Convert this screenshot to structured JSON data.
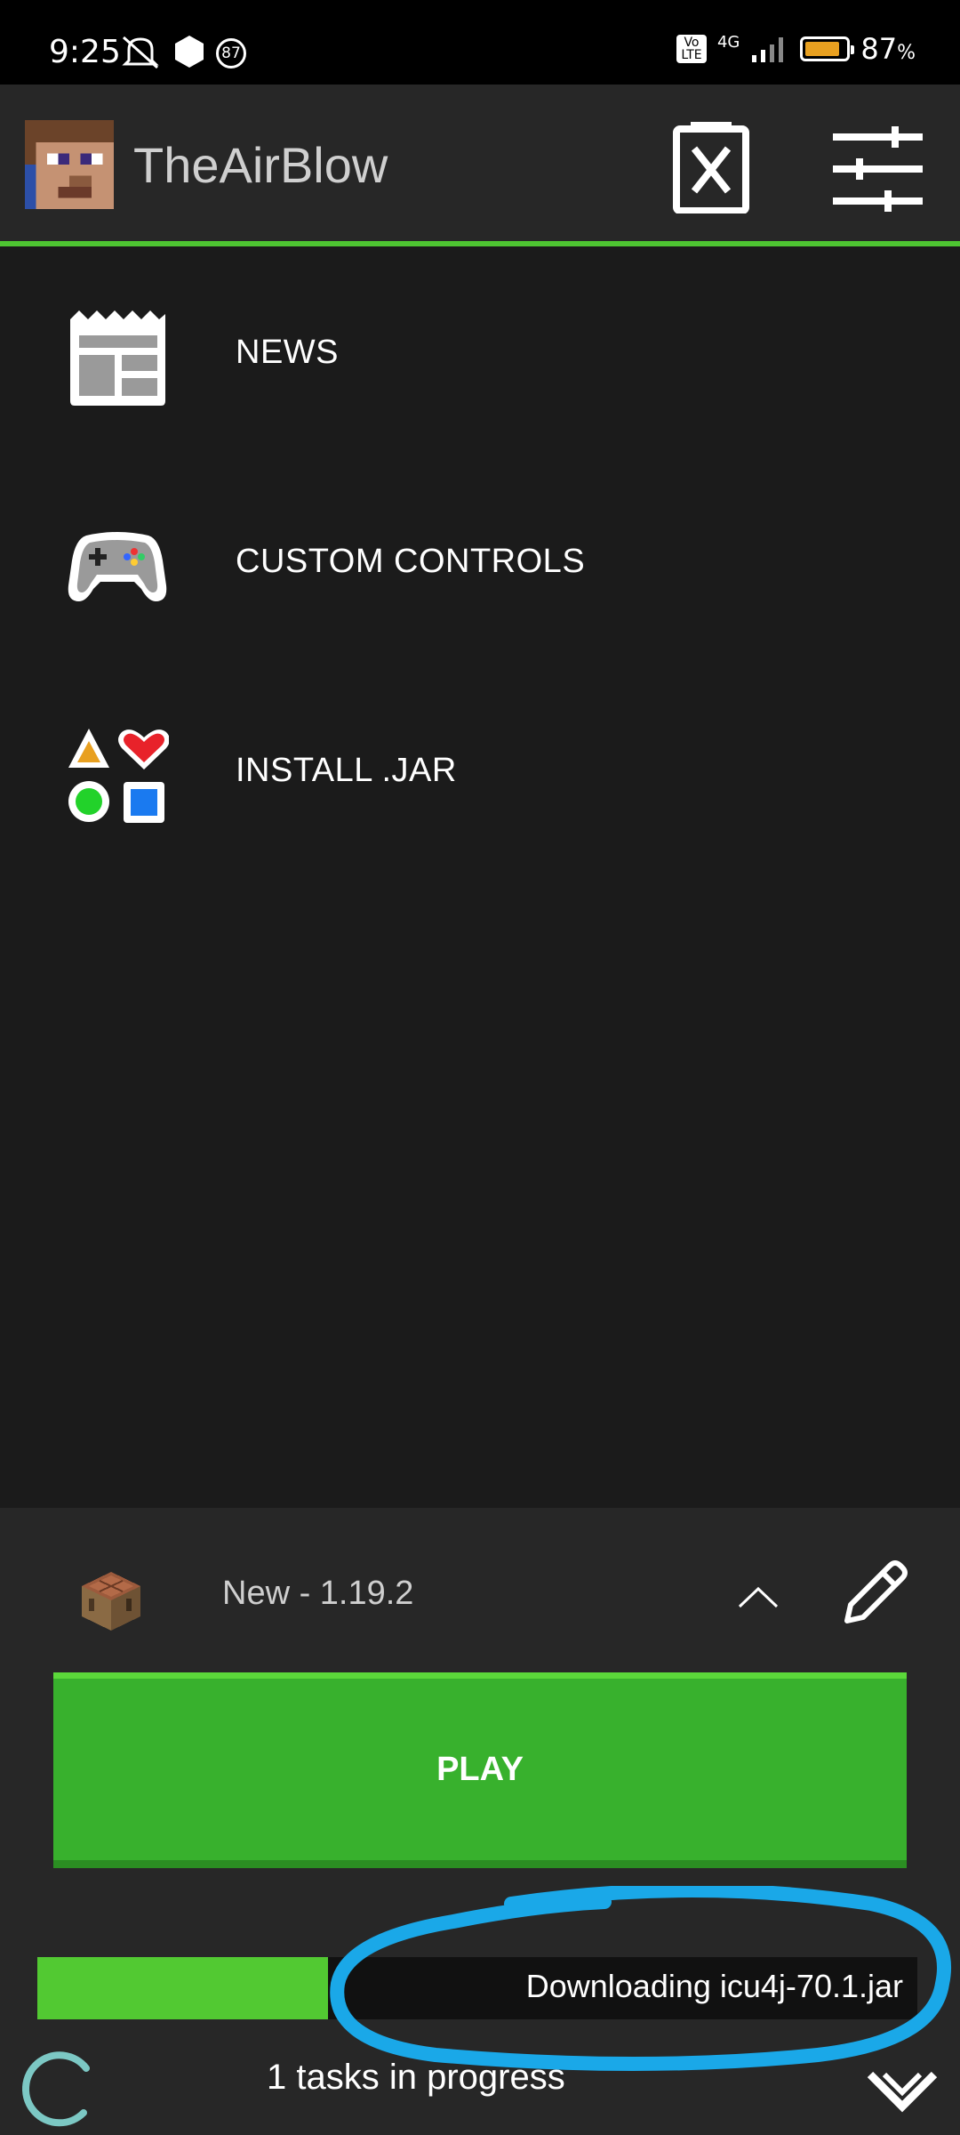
{
  "status_bar": {
    "time": "9:25",
    "notification_badge": "87",
    "network": "4G",
    "volte": "Vo LTE",
    "battery_percent": "87",
    "battery_unit": "%",
    "battery_level": 0.87,
    "battery_color": "#e8a020"
  },
  "header": {
    "username": "TheAirBlow",
    "accent_color": "#4ec532"
  },
  "menu": {
    "items": [
      {
        "label": "NEWS",
        "icon": "newspaper-icon"
      },
      {
        "label": "CUSTOM CONTROLS",
        "icon": "gamepad-icon"
      },
      {
        "label": "INSTALL .JAR",
        "icon": "shapes-icon"
      }
    ]
  },
  "profile": {
    "name": "New - 1.19.2",
    "icon": "crafting-table-icon"
  },
  "play": {
    "label": "PLAY",
    "color": "#38b12d"
  },
  "download": {
    "text": "Downloading icu4j-70.1.jar",
    "progress": 0.33
  },
  "tasks": {
    "text": "1 tasks in progress"
  }
}
